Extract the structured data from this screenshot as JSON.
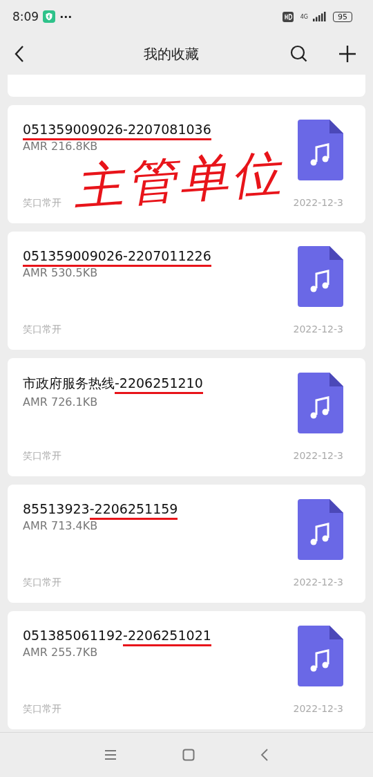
{
  "status_bar": {
    "time": "8:09",
    "dots": "···",
    "network": "4G",
    "battery": "95"
  },
  "header": {
    "title": "我的收藏"
  },
  "items": [
    {
      "title": "051359009026-2207081036",
      "info": "AMR 216.8KB",
      "note": "笑口常开",
      "date": "2022-12-3",
      "underlined": true,
      "underline_whole": true
    },
    {
      "title": "051359009026-2207011226",
      "info": "AMR 530.5KB",
      "note": "笑口常开",
      "date": "2022-12-3",
      "underlined": true,
      "underline_whole": true
    },
    {
      "title": "市政府服务热线-2206251210",
      "info": "AMR 726.1KB",
      "note": "笑口常开",
      "date": "2022-12-3",
      "underlined": true,
      "underline_whole": false
    },
    {
      "title": "85513923-2206251159",
      "info": "AMR 713.4KB",
      "note": "笑口常开",
      "date": "2022-12-3",
      "underlined": true,
      "underline_whole": false
    },
    {
      "title": "051385061192-2206251021",
      "info": "AMR 255.7KB",
      "note": "笑口常开",
      "date": "2022-12-3",
      "underlined": true,
      "underline_whole": false
    }
  ],
  "annotation": {
    "kind": "handwriting",
    "text": "主管单位"
  }
}
